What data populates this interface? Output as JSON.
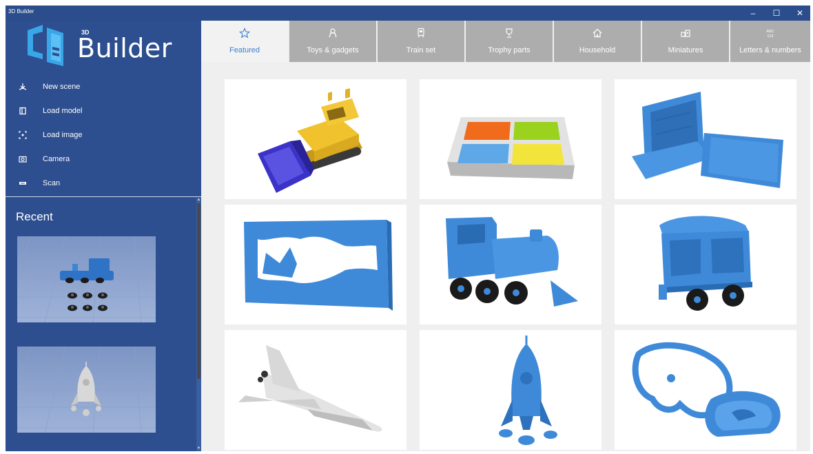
{
  "window": {
    "title": "3D Builder",
    "controls": [
      "–",
      "☐",
      "✕"
    ]
  },
  "logo": {
    "prefix": "3D",
    "word": "Builder"
  },
  "menu": [
    {
      "label": "New scene",
      "icon": "new-scene-icon"
    },
    {
      "label": "Load model",
      "icon": "load-model-icon"
    },
    {
      "label": "Load image",
      "icon": "load-image-icon"
    },
    {
      "label": "Camera",
      "icon": "camera-icon"
    },
    {
      "label": "Scan",
      "icon": "scan-icon"
    }
  ],
  "recent": {
    "title": "Recent",
    "items": [
      {
        "label": "train scene",
        "icon": "train-thumbnail"
      },
      {
        "label": "rocket scene",
        "icon": "rocket-thumbnail"
      }
    ]
  },
  "tabs": [
    {
      "label": "Featured",
      "icon": "star-icon",
      "active": true
    },
    {
      "label": "Toys & gadgets",
      "icon": "toys-icon",
      "active": false
    },
    {
      "label": "Train set",
      "icon": "train-icon",
      "active": false
    },
    {
      "label": "Trophy parts",
      "icon": "trophy-icon",
      "active": false
    },
    {
      "label": "Household",
      "icon": "house-icon",
      "active": false
    },
    {
      "label": "Miniatures",
      "icon": "miniatures-icon",
      "active": false
    },
    {
      "label": "Letters & numbers",
      "icon": "abc-icon",
      "active": false
    }
  ],
  "models": [
    {
      "name": "bulldozer-model",
      "icon": "bulldozer-icon"
    },
    {
      "name": "tile-tray-model",
      "icon": "tile-tray-icon"
    },
    {
      "name": "case-model",
      "icon": "case-icon"
    },
    {
      "name": "bottle-frame-model",
      "icon": "bottle-frame-icon"
    },
    {
      "name": "locomotive-model",
      "icon": "locomotive-icon"
    },
    {
      "name": "train-car-model",
      "icon": "train-car-icon"
    },
    {
      "name": "shuttle-model",
      "icon": "shuttle-icon"
    },
    {
      "name": "rocket-model",
      "icon": "rocket-icon"
    },
    {
      "name": "cookie-cutter-model",
      "icon": "cookie-cutter-icon"
    }
  ],
  "colors": {
    "sidebar": "#2d4e8f",
    "titlebar": "#2b4d8c",
    "tab_inactive": "#adadad",
    "tab_active_text": "#3a7fd0",
    "model_blue": "#3f8ad8"
  }
}
